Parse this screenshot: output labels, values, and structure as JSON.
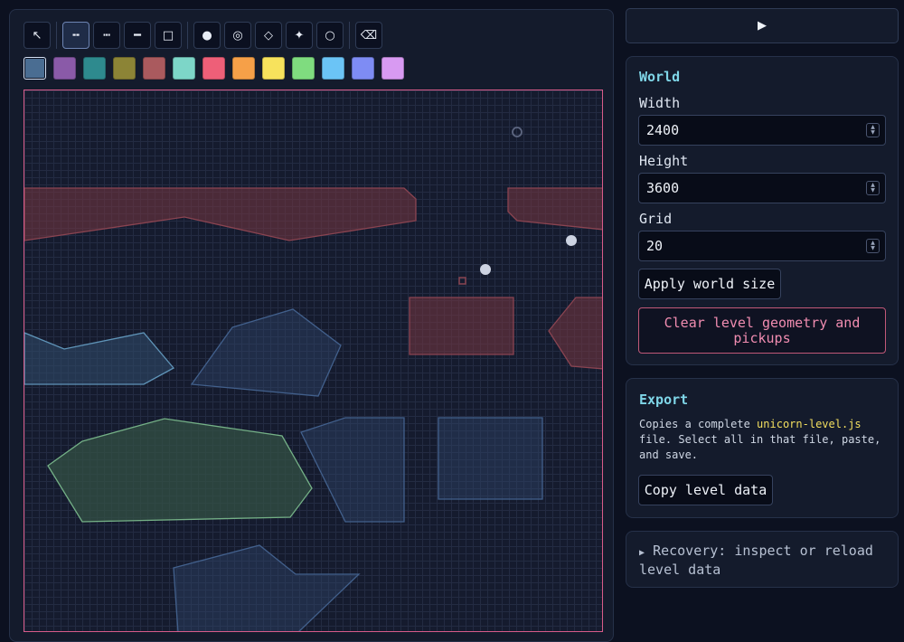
{
  "toolbar": {
    "tools": [
      {
        "name": "select",
        "glyph": "↖",
        "active": false
      },
      {
        "name": "line-dashed-bold",
        "glyph": "╍",
        "active": true
      },
      {
        "name": "line-dotted",
        "glyph": "┅",
        "active": false
      },
      {
        "name": "line-solid",
        "glyph": "━",
        "active": false
      },
      {
        "name": "rectangle",
        "glyph": "□",
        "active": false
      },
      {
        "name": "pickup-dot",
        "glyph": "●",
        "active": false
      },
      {
        "name": "target",
        "glyph": "◎",
        "active": false
      },
      {
        "name": "diamond",
        "glyph": "◇",
        "active": false
      },
      {
        "name": "star",
        "glyph": "✦",
        "active": false
      },
      {
        "name": "ring",
        "glyph": "○",
        "active": false
      },
      {
        "name": "erase",
        "glyph": "⌫",
        "active": false
      }
    ]
  },
  "palette": [
    "#4a6d92",
    "#8a5aa8",
    "#2e8a8e",
    "#8c8436",
    "#aa5a5e",
    "#7dd6c8",
    "#ee5f78",
    "#f6a048",
    "#f7e25c",
    "#7fdc7f",
    "#6bc4f6",
    "#7e8cf4",
    "#d89af2"
  ],
  "palette_selected": 0,
  "canvas": {
    "border_color": "#d85c8a",
    "shapes": [
      {
        "kind": "polygon",
        "fill": "rgba(120,54,66,0.55)",
        "stroke": "#8a4451"
      },
      {
        "kind": "polygon",
        "fill": "rgba(120,54,66,0.55)",
        "stroke": "#8a4451"
      },
      {
        "kind": "polygon",
        "fill": "rgba(46,74,104,0.6)",
        "stroke": "#5f94b8"
      },
      {
        "kind": "polygon",
        "fill": "rgba(46,68,104,0.45)",
        "stroke": "#42608c"
      },
      {
        "kind": "polygon",
        "fill": "rgba(120,54,66,0.55)",
        "stroke": "#8a4451"
      },
      {
        "kind": "polygon",
        "fill": "rgba(120,54,66,0.55)",
        "stroke": "#8a4451"
      },
      {
        "kind": "polygon",
        "fill": "rgba(52,84,70,0.7)",
        "stroke": "#74b086"
      },
      {
        "kind": "polygon",
        "fill": "rgba(46,68,104,0.45)",
        "stroke": "#42608c"
      },
      {
        "kind": "polygon",
        "fill": "rgba(46,68,104,0.45)",
        "stroke": "#42608c"
      },
      {
        "kind": "polygon",
        "fill": "rgba(46,68,104,0.45)",
        "stroke": "#42608c"
      }
    ],
    "pickups": [
      {
        "kind": "ring",
        "color": "#5d6680"
      },
      {
        "kind": "dot",
        "color": "#cdd3e2"
      },
      {
        "kind": "dot",
        "color": "#cdd3e2"
      },
      {
        "kind": "square",
        "color": "#8a4451"
      }
    ]
  },
  "run_button": {
    "icon": "play-icon",
    "glyph": "▶"
  },
  "world": {
    "title": "World",
    "width_label": "Width",
    "width_value": "2400",
    "height_label": "Height",
    "height_value": "3600",
    "grid_label": "Grid",
    "grid_value": "20",
    "apply_label": "Apply world size",
    "clear_label": "Clear level geometry and pickups"
  },
  "export": {
    "title": "Export",
    "desc_before": "Copies a complete ",
    "desc_code": "unicorn-level.js",
    "desc_after": " file. Select all in that file, paste, and save.",
    "copy_label": "Copy level data"
  },
  "recovery": {
    "arrow": "▶",
    "label": "Recovery: inspect or reload level data"
  },
  "colors": {
    "accent": "#7fd6e8",
    "danger": "#f08cb0",
    "code": "#f3df5f"
  }
}
